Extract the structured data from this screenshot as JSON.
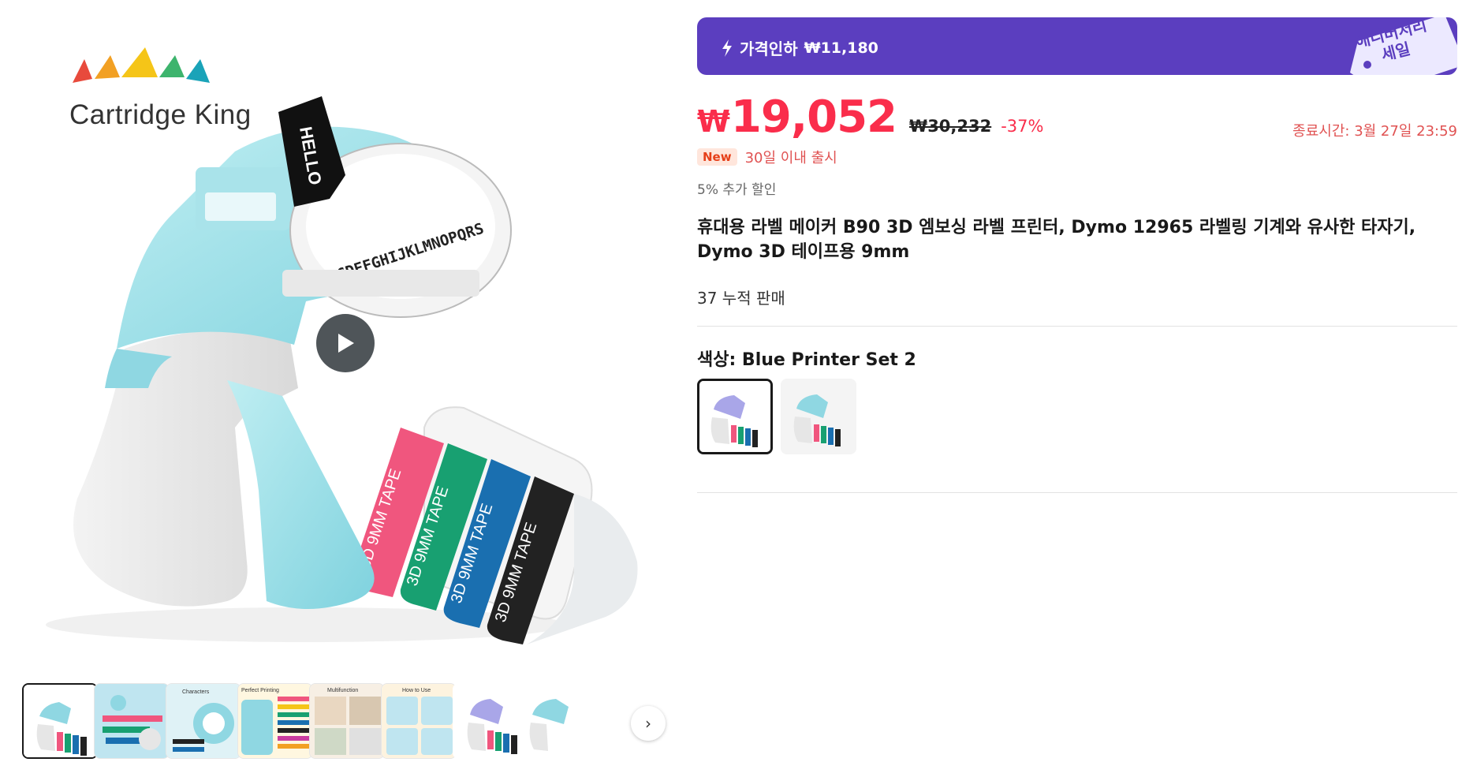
{
  "gallery": {
    "logo_text": "Cartridge King",
    "tape_labels": [
      "3D 9MM TAPE",
      "3D 9MM TAPE",
      "3D 9MM TAPE",
      "3D 9MM TAPE"
    ],
    "tape_colors": [
      "#f0567e",
      "#18a071",
      "#1a6fb0",
      "#222222"
    ],
    "wheel_letters": "ABCDEFGHIJKLMNOPQRS",
    "hello_text": "HELLO",
    "thumbnails": [
      {
        "name": "thumb-blue-printer",
        "active": true
      },
      {
        "name": "thumb-accessories",
        "active": false
      },
      {
        "name": "thumb-characters",
        "active": false
      },
      {
        "name": "thumb-perfect-printing",
        "active": false
      },
      {
        "name": "thumb-multifunction",
        "active": false
      },
      {
        "name": "thumb-how-to-use",
        "active": false
      },
      {
        "name": "thumb-purple-printer",
        "active": false
      },
      {
        "name": "thumb-partial",
        "active": false
      }
    ],
    "thumb_texts": {
      "characters": "Characters",
      "perfect_printing": "Perfect Printing",
      "multifunction": "Multifunction",
      "how_to_use": "How to Use"
    },
    "next_icon": "›"
  },
  "promo": {
    "label": "가격인하",
    "amount_currency": "₩",
    "amount": "11,180",
    "tag_text": "애니버서리 세일",
    "bg_color": "#5b3ebf"
  },
  "price": {
    "currency": "₩",
    "current": "19,052",
    "original": "₩30,232",
    "discount": "-37%",
    "end_time": "종료시간: 3월 27일 23:59",
    "accent_color": "#fa2d4b"
  },
  "badge": {
    "new": "New",
    "new_text": "30일 이내 출시"
  },
  "extra_discount": "5% 추가 할인",
  "product": {
    "title": "휴대용 라벨 메이커 B90 3D 엠보싱 라벨 프린터, Dymo 12965 라벨링 기계와 유사한 타자기, Dymo 3D 테이프용 9mm",
    "sold": "37 누적 판매"
  },
  "color": {
    "label": "색상: Blue Printer Set 2",
    "options": [
      {
        "name": "purple-printer-set",
        "selected": true
      },
      {
        "name": "blue-printer-set-2",
        "selected": false
      }
    ]
  }
}
